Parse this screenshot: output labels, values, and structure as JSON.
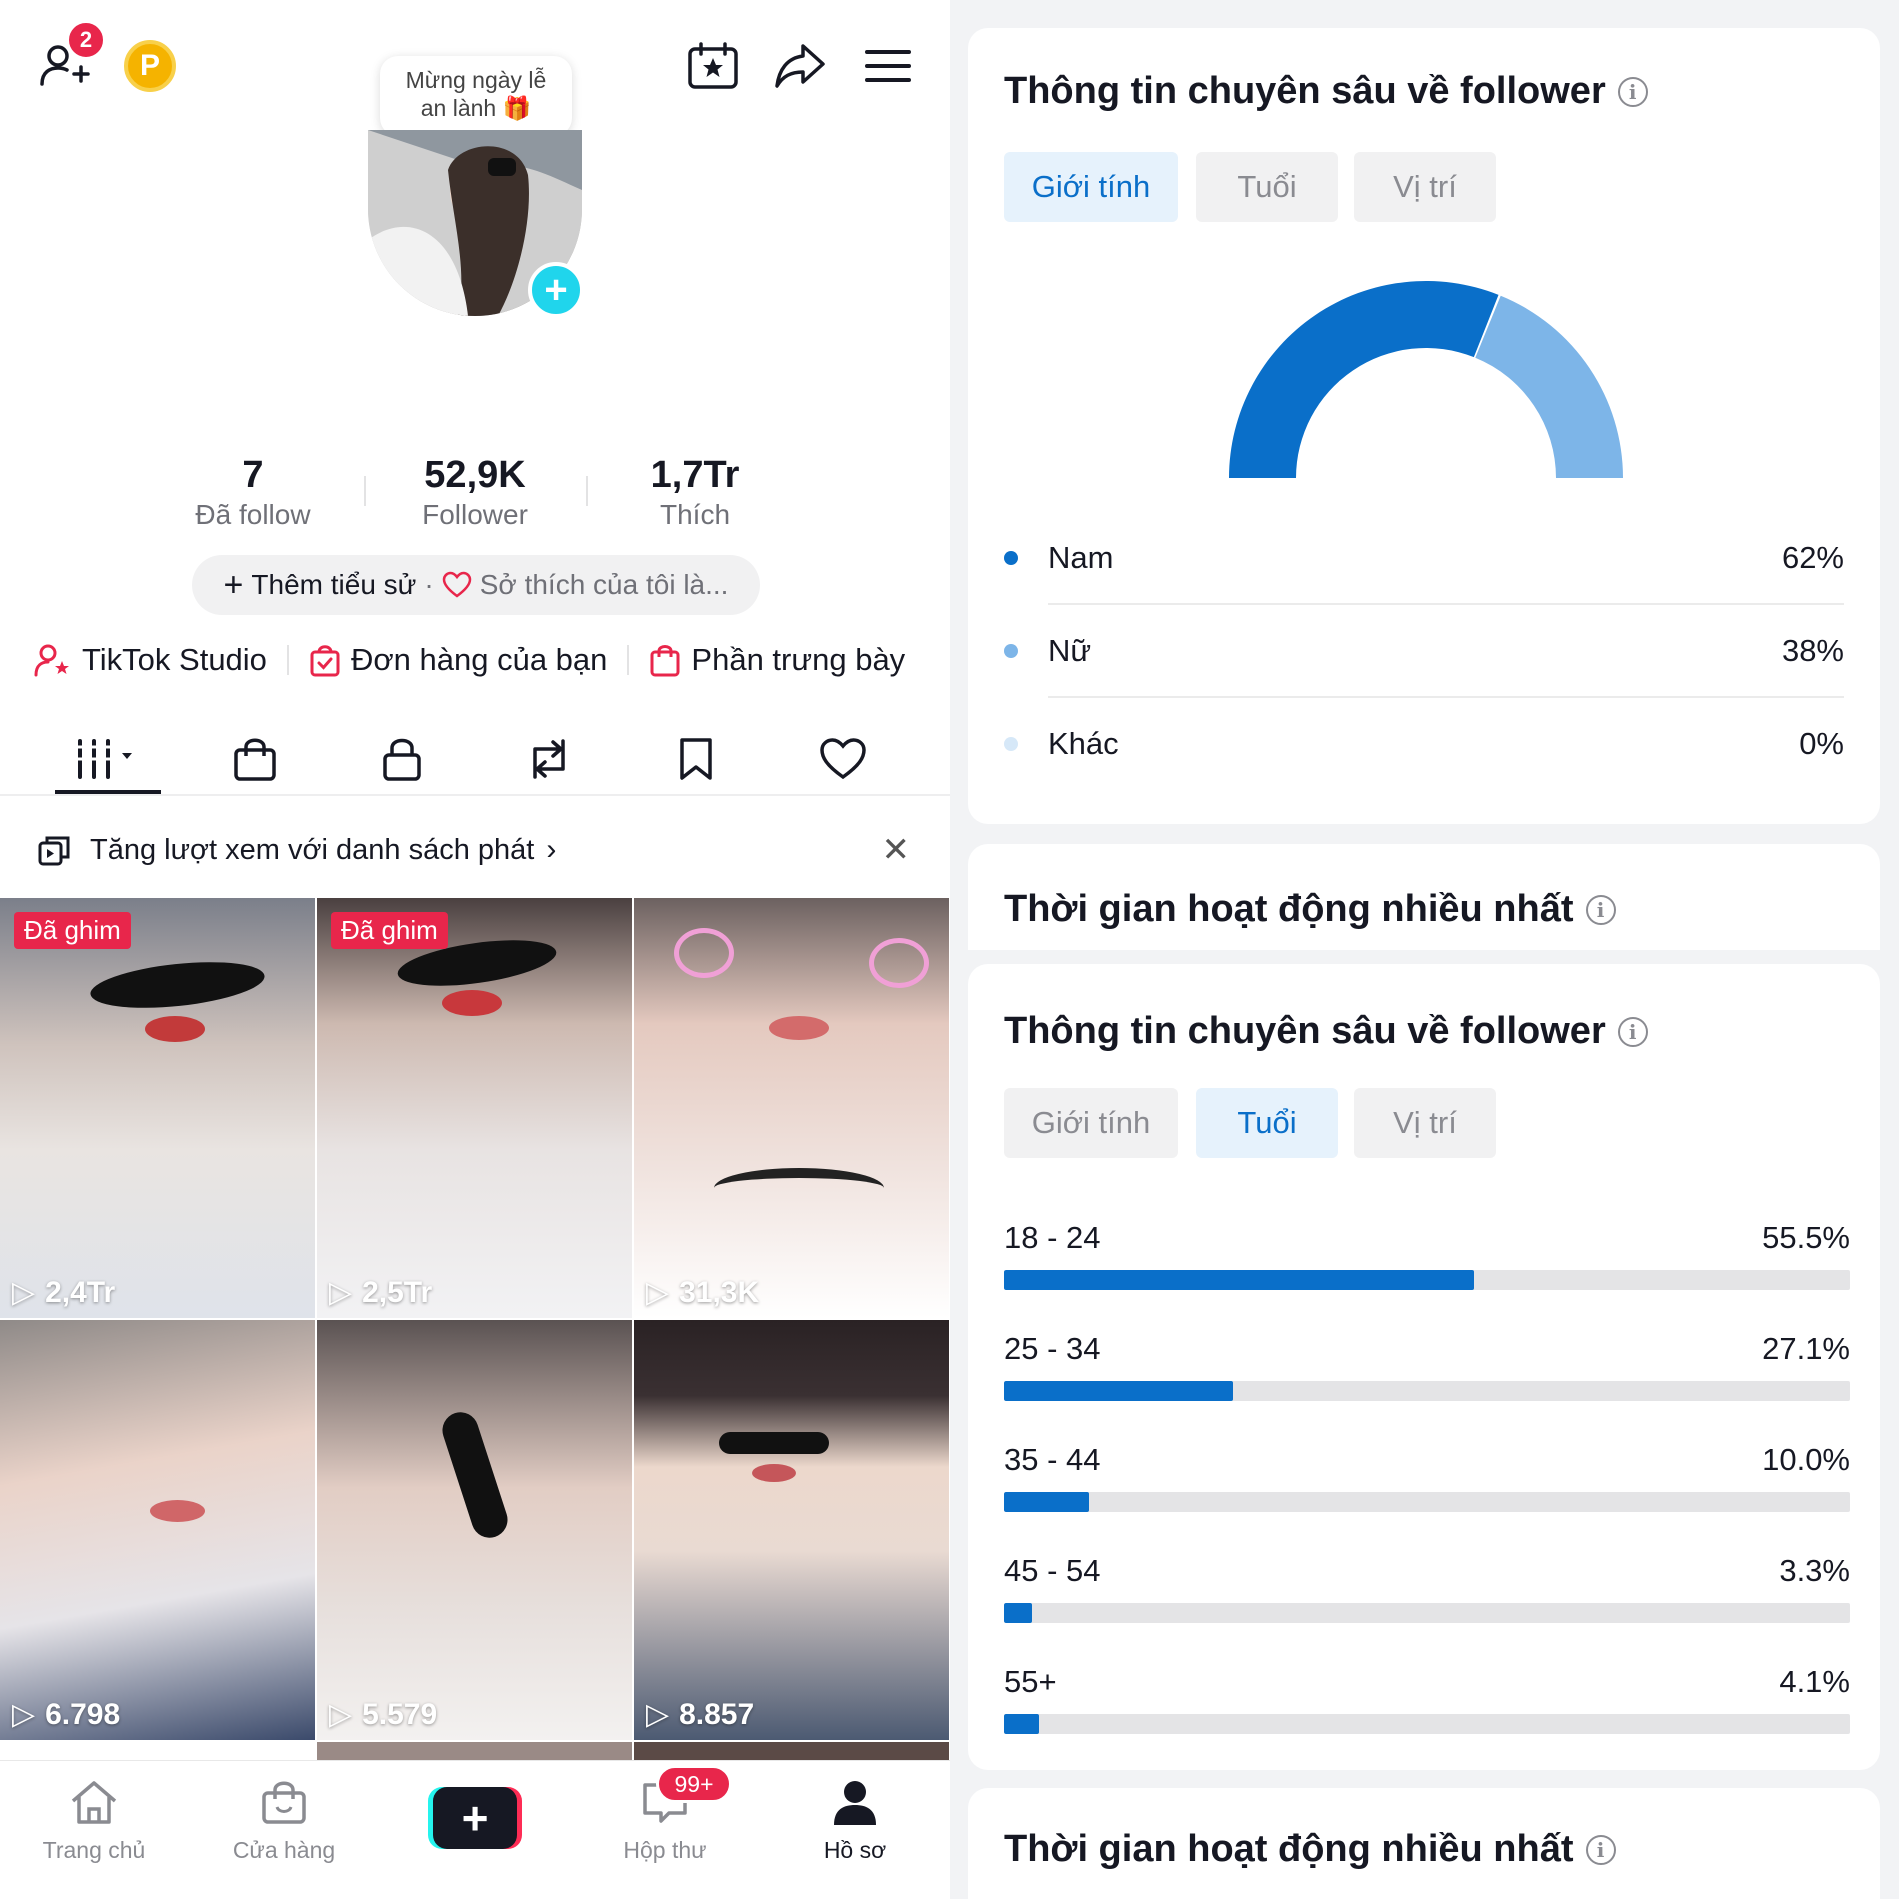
{
  "profile": {
    "notification_count": "2",
    "coin_letter": "P",
    "greeting_line1": "Mừng ngày lễ",
    "greeting_line2": "an lành 🎁",
    "stats": [
      {
        "value": "7",
        "label": "Đã follow"
      },
      {
        "value": "52,9K",
        "label": "Follower"
      },
      {
        "value": "1,7Tr",
        "label": "Thích"
      }
    ],
    "bio_add": "Thêm tiểu sử",
    "bio_dot": "·",
    "bio_hobby": "Sở thích của tôi là...",
    "links": [
      {
        "label": "TikTok Studio",
        "icon": "user-star-icon"
      },
      {
        "label": "Đơn hàng của bạn",
        "icon": "order-bag-icon"
      },
      {
        "label": "Phần trưng bày",
        "icon": "shop-bag-icon"
      }
    ],
    "tabs": [
      "videos-grid-icon",
      "shop-bag-icon",
      "lock-icon",
      "repost-icon",
      "bookmark-icon",
      "heart-icon"
    ],
    "playlist_promo": "Tăng lượt xem với danh sách phát",
    "videos": [
      {
        "pinned": "Đã ghim",
        "views": "2,4Tr"
      },
      {
        "pinned": "Đã ghim",
        "views": "2,5Tr"
      },
      {
        "pinned": "",
        "views": "31,3K"
      },
      {
        "pinned": "",
        "views": "6.798"
      },
      {
        "pinned": "",
        "views": "5.579"
      },
      {
        "pinned": "",
        "views": "8.857"
      }
    ],
    "nav": {
      "home": "Trang chủ",
      "shop": "Cửa hàng",
      "inbox": "Hộp thư",
      "inbox_badge": "99+",
      "profile": "Hồ sơ"
    }
  },
  "insights": {
    "gender_card": {
      "title": "Thông tin chuyên sâu về follower",
      "tabs": [
        "Giới tính",
        "Tuổi",
        "Vị trí"
      ],
      "active_tab": "Giới tính",
      "legend": [
        {
          "label": "Nam",
          "value": "62%",
          "color": "#0a6fc9"
        },
        {
          "label": "Nữ",
          "value": "38%",
          "color": "#7db5e8"
        },
        {
          "label": "Khác",
          "value": "0%",
          "color": "#d6e8f8"
        }
      ]
    },
    "active_time_title": "Thời gian hoạt động nhiều nhất",
    "age_card": {
      "title": "Thông tin chuyên sâu về follower",
      "tabs": [
        "Giới tính",
        "Tuổi",
        "Vị trí"
      ],
      "active_tab": "Tuổi",
      "rows": [
        {
          "label": "18 - 24",
          "value": "55.5%"
        },
        {
          "label": "25 - 34",
          "value": "27.1%"
        },
        {
          "label": "35 - 44",
          "value": "10.0%"
        },
        {
          "label": "45 - 54",
          "value": "3.3%"
        },
        {
          "label": "55+",
          "value": "4.1%"
        }
      ]
    },
    "active_time_title_2": "Thời gian hoạt động nhiều nhất"
  },
  "chart_data": [
    {
      "type": "pie",
      "title": "",
      "categories": [
        "Nam",
        "Nữ",
        "Khác"
      ],
      "values": [
        62,
        38,
        0
      ],
      "colors": [
        "#0a6fc9",
        "#7db5e8",
        "#d6e8f8"
      ]
    },
    {
      "type": "bar",
      "title": "",
      "categories": [
        "18 - 24",
        "25 - 34",
        "35 - 44",
        "45 - 54",
        "55+"
      ],
      "values": [
        55.5,
        27.1,
        10.0,
        3.3,
        4.1
      ],
      "ylim": [
        0,
        100
      ]
    }
  ]
}
